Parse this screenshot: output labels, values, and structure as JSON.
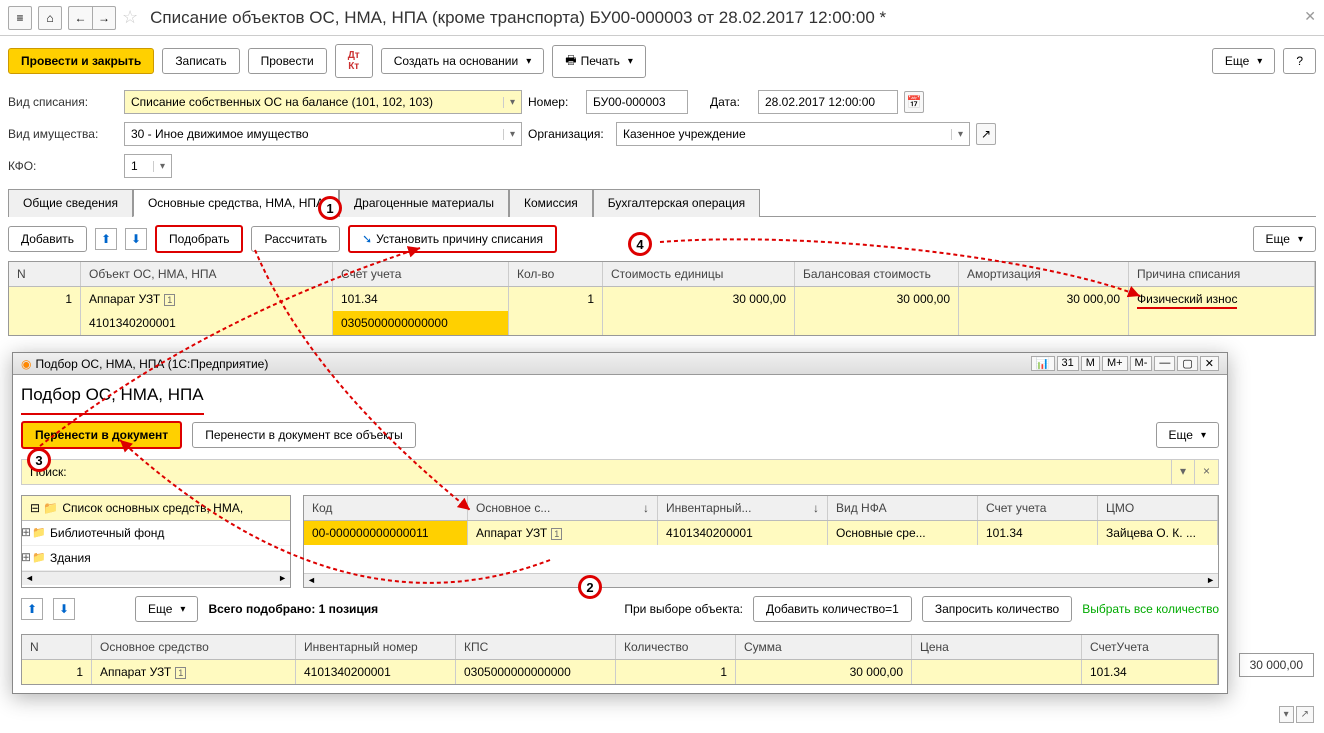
{
  "header": {
    "title": "Списание объектов ОС, НМА, НПА (кроме транспорта) БУ00-000003 от 28.02.2017 12:00:00 *"
  },
  "toolbar": {
    "post_close": "Провести и закрыть",
    "save": "Записать",
    "post": "Провести",
    "create_based": "Создать на основании",
    "print": "Печать",
    "more": "Еще",
    "help": "?"
  },
  "form": {
    "type_label": "Вид списания:",
    "type_value": "Списание собственных ОС на балансе (101, 102, 103)",
    "number_label": "Номер:",
    "number_value": "БУ00-000003",
    "date_label": "Дата:",
    "date_value": "28.02.2017 12:00:00",
    "prop_label": "Вид имущества:",
    "prop_value": "30 - Иное движимое имущество",
    "org_label": "Организация:",
    "org_value": "Казенное учреждение",
    "kfo_label": "КФО:",
    "kfo_value": "1"
  },
  "tabs": [
    "Общие сведения",
    "Основные средства, НМА, НПА",
    "Драгоценные материалы",
    "Комиссия",
    "Бухгалтерская операция"
  ],
  "subbar": {
    "add": "Добавить",
    "pick": "Подобрать",
    "calc": "Рассчитать",
    "set_reason": "Установить причину списания",
    "more": "Еще"
  },
  "main_table": {
    "headers": [
      "N",
      "Объект ОС, НМА, НПА",
      "Счет учета",
      "Кол-во",
      "Стоимость единицы",
      "Балансовая стоимость",
      "Амортизация",
      "Причина списания"
    ],
    "row1": {
      "n": "1",
      "obj": "Аппарат УЗТ",
      "obj2": "4101340200001",
      "acc": "101.34",
      "acc2": "0305000000000000",
      "qty": "1",
      "unit_cost": "30 000,00",
      "bal_cost": "30 000,00",
      "amort": "30 000,00",
      "reason": "Физический износ"
    }
  },
  "dialog": {
    "wintitle": "Подбор ОС, НМА, НПА  (1С:Предприятие)",
    "title": "Подбор ОС, НМА, НПА",
    "transfer": "Перенести в документ",
    "transfer_all": "Перенести в документ все объекты",
    "more": "Еще",
    "search_label": "Поиск:",
    "tree_head": "Список основных средств, НМА,",
    "tree_items": [
      "Библиотечный фонд",
      "Здания"
    ],
    "sel_headers": [
      "Код",
      "Основное с...",
      "Инвентарный...",
      "Вид НФА",
      "Счет учета",
      "ЦМО"
    ],
    "sel_row": {
      "code": "00-000000000000011",
      "name": "Аппарат УЗТ",
      "inv": "4101340200001",
      "kind": "Основные сре...",
      "acc": "101.34",
      "cmo": "Зайцева О. К. ..."
    },
    "picked_label": "Всего подобрано: 1 позиция",
    "on_select": "При выборе объекта:",
    "add_qty1": "Добавить количество=1",
    "ask_qty": "Запросить количество",
    "sel_all_qty": "Выбрать все количество",
    "bot_headers": [
      "N",
      "Основное средство",
      "Инвентарный номер",
      "КПС",
      "Количество",
      "Сумма",
      "Цена",
      "СчетУчета"
    ],
    "bot_row": {
      "n": "1",
      "name": "Аппарат УЗТ",
      "inv": "4101340200001",
      "kps": "0305000000000000",
      "qty": "1",
      "sum": "30 000,00",
      "price": "",
      "acc": "101.34"
    }
  },
  "footer_total": "30 000,00",
  "markers": {
    "m1": "1",
    "m2": "2",
    "m3": "3",
    "m4": "4"
  }
}
